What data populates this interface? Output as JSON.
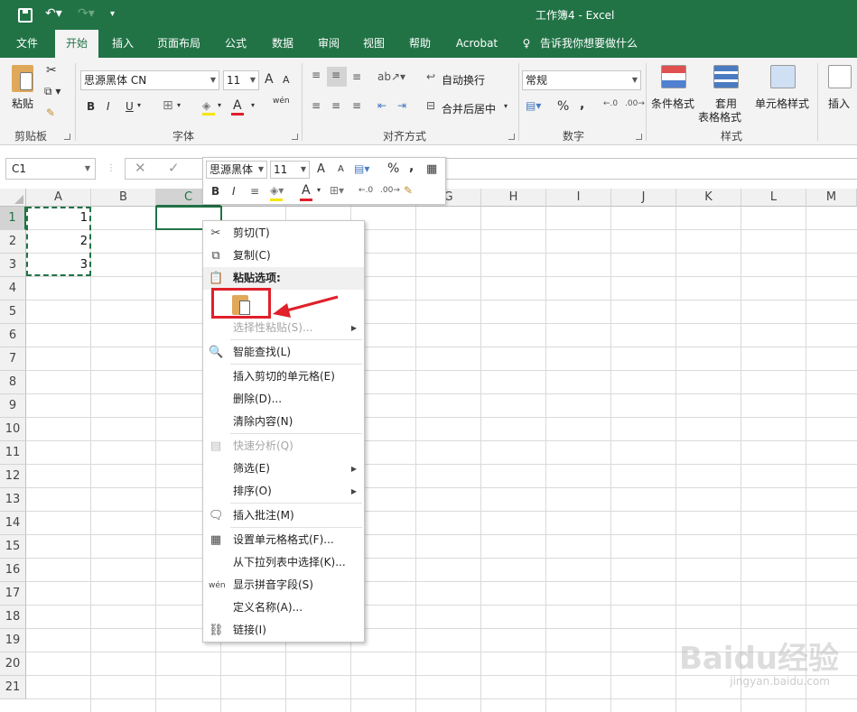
{
  "app": {
    "title": "工作簿4  -  Excel"
  },
  "tabs": [
    "文件",
    "开始",
    "插入",
    "页面布局",
    "公式",
    "数据",
    "审阅",
    "视图",
    "帮助",
    "Acrobat",
    "告诉我你想要做什么"
  ],
  "ribbon": {
    "clipboard": {
      "paste": "粘贴",
      "group": "剪贴板"
    },
    "font": {
      "name": "思源黑体 CN",
      "size": "11",
      "group": "字体",
      "bold": "B",
      "italic": "I",
      "underline": "U",
      "grow": "A",
      "shrink": "A",
      "color_a": "A",
      "phonetic": "wén"
    },
    "alignment": {
      "wrap": "自动换行",
      "merge": "合并后居中",
      "group": "对齐方式"
    },
    "number": {
      "format": "常规",
      "percent": "%",
      "comma": ",",
      "group": "数字"
    },
    "styles": {
      "conditional": "条件格式",
      "table_a": "套用",
      "table_b": "表格格式",
      "cell": "单元格样式",
      "group": "样式"
    },
    "cells": {
      "insert": "插入"
    }
  },
  "formula_bar": {
    "name_box": "C1",
    "cancel": "✕",
    "enter": "✓"
  },
  "columns": [
    "A",
    "B",
    "C",
    "D",
    "E",
    "F",
    "G",
    "H",
    "I",
    "J",
    "K",
    "L",
    "M"
  ],
  "rows": [
    "1",
    "2",
    "3",
    "4",
    "5",
    "6",
    "7",
    "8",
    "9",
    "10",
    "11",
    "12",
    "13",
    "14",
    "15",
    "16",
    "17",
    "18",
    "19",
    "20",
    "21"
  ],
  "cells": {
    "A1": "1",
    "A2": "2",
    "A3": "3"
  },
  "mini_toolbar": {
    "font": "思源黑体",
    "size": "11",
    "percent": "%",
    "comma": ","
  },
  "context_menu": {
    "cut": "剪切(T)",
    "copy": "复制(C)",
    "paste_options": "粘贴选项:",
    "paste_special": "选择性粘贴(S)...",
    "smart_lookup": "智能查找(L)",
    "insert_cut": "插入剪切的单元格(E)",
    "delete": "删除(D)...",
    "clear": "清除内容(N)",
    "quick_analysis": "快速分析(Q)",
    "filter": "筛选(E)",
    "sort": "排序(O)",
    "insert_comment": "插入批注(M)",
    "format_cells": "设置单元格格式(F)...",
    "pick_list": "从下拉列表中选择(K)...",
    "phonetic": "显示拼音字段(S)",
    "define_name": "定义名称(A)...",
    "link": "链接(I)"
  },
  "watermark": {
    "main": "Baidu经验",
    "sub": "jingyan.baidu.com"
  },
  "colors": {
    "excel_green": "#217346",
    "highlight_red": "#e0202a"
  }
}
